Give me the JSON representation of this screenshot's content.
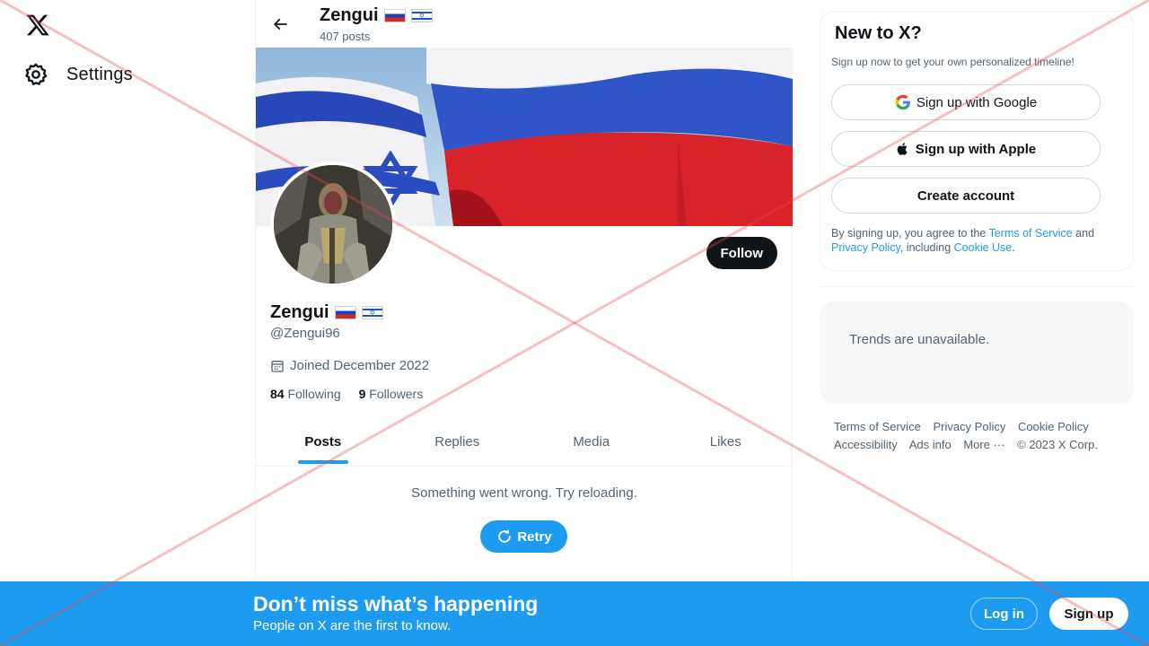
{
  "nav": {
    "settings_label": "Settings"
  },
  "topbar": {
    "name": "Zengui",
    "post_count": "407 posts"
  },
  "profile": {
    "name": "Zengui",
    "handle": "@Zengui96",
    "joined": "Joined December 2022",
    "following_count": "84",
    "following_label": "Following",
    "followers_count": "9",
    "followers_label": "Followers",
    "follow_label": "Follow"
  },
  "tabs": [
    {
      "label": "Posts",
      "active": true
    },
    {
      "label": "Replies"
    },
    {
      "label": "Media"
    },
    {
      "label": "Likes"
    }
  ],
  "feed": {
    "error": "Something went wrong. Try reloading.",
    "retry_label": "Retry"
  },
  "signup_card": {
    "title": "New to X?",
    "subtitle": "Sign up now to get your own personalized timeline!",
    "google_label": "Sign up with Google",
    "apple_label": "Sign up with Apple",
    "create_label": "Create account",
    "legal_pre": "By signing up, you agree to the ",
    "terms_link": "Terms of Service",
    "legal_and": " and ",
    "privacy_link": "Privacy Policy",
    "legal_including": ", including ",
    "cookie_link": "Cookie Use",
    "legal_end": "."
  },
  "trends": {
    "message": "Trends are unavailable."
  },
  "footer": {
    "links": [
      "Terms of Service",
      "Privacy Policy",
      "Cookie Policy",
      "Accessibility",
      "Ads info",
      "More ···"
    ],
    "copyright": "© 2023 X Corp."
  },
  "bottom_bar": {
    "title": "Don’t miss what’s happening",
    "subtitle": "People on X are the first to know.",
    "login_label": "Log in",
    "signup_label": "Sign up"
  },
  "colors": {
    "accent": "#1d9bf0",
    "text": "#0f1419",
    "muted": "#536471",
    "overlay_red": "#e8474b"
  }
}
